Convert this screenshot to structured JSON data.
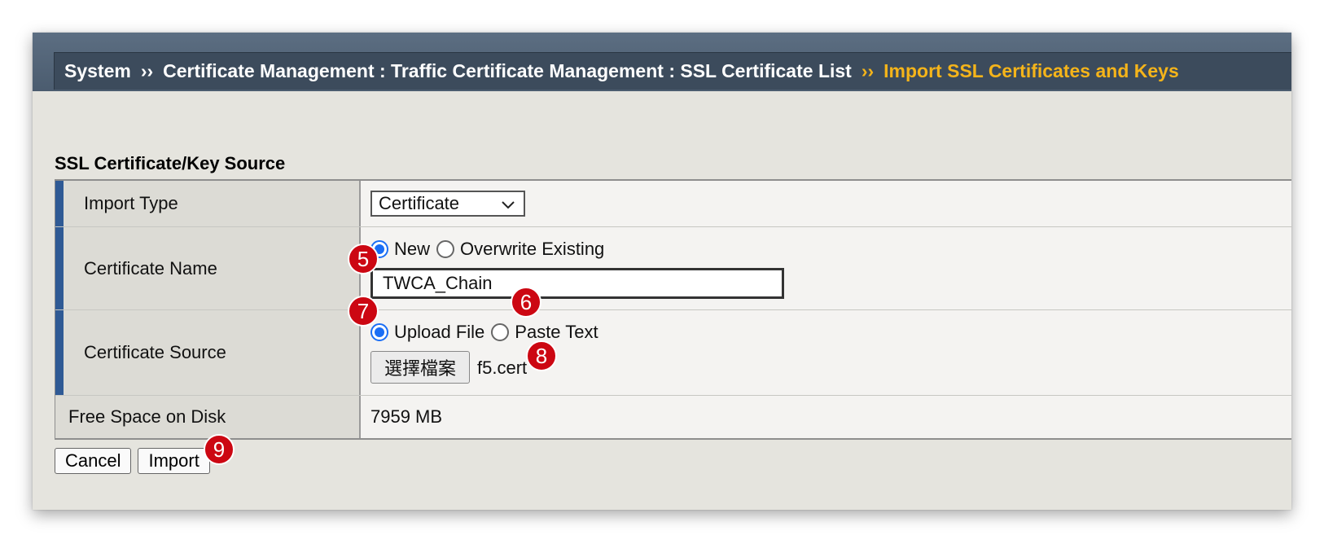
{
  "breadcrumb": {
    "items": [
      "System",
      "Certificate Management : Traffic Certificate Management : SSL Certificate List"
    ],
    "separator": "››",
    "current": "Import SSL Certificates and Keys"
  },
  "section_title": "SSL Certificate/Key Source",
  "form": {
    "import_type": {
      "label": "Import Type",
      "selected": "Certificate"
    },
    "certificate_name": {
      "label": "Certificate Name",
      "options": [
        "New",
        "Overwrite Existing"
      ],
      "selected": "New",
      "value": "TWCA_Chain"
    },
    "certificate_source": {
      "label": "Certificate Source",
      "options": [
        "Upload File",
        "Paste Text"
      ],
      "selected": "Upload File",
      "choose_file_label": "選擇檔案",
      "file_name": "f5.cert"
    },
    "free_space": {
      "label": "Free Space on Disk",
      "value": "7959 MB"
    }
  },
  "buttons": {
    "cancel": "Cancel",
    "import": "Import"
  },
  "annotations": [
    "5",
    "6",
    "7",
    "8",
    "9"
  ],
  "colors": {
    "accent_gold": "#f5b41a",
    "required_bar": "#2f5a95",
    "radio_selected": "#1a6ef5",
    "annotation_badge": "#cc0712"
  },
  "icons": {
    "select_arrow": "chevron-down-icon"
  }
}
